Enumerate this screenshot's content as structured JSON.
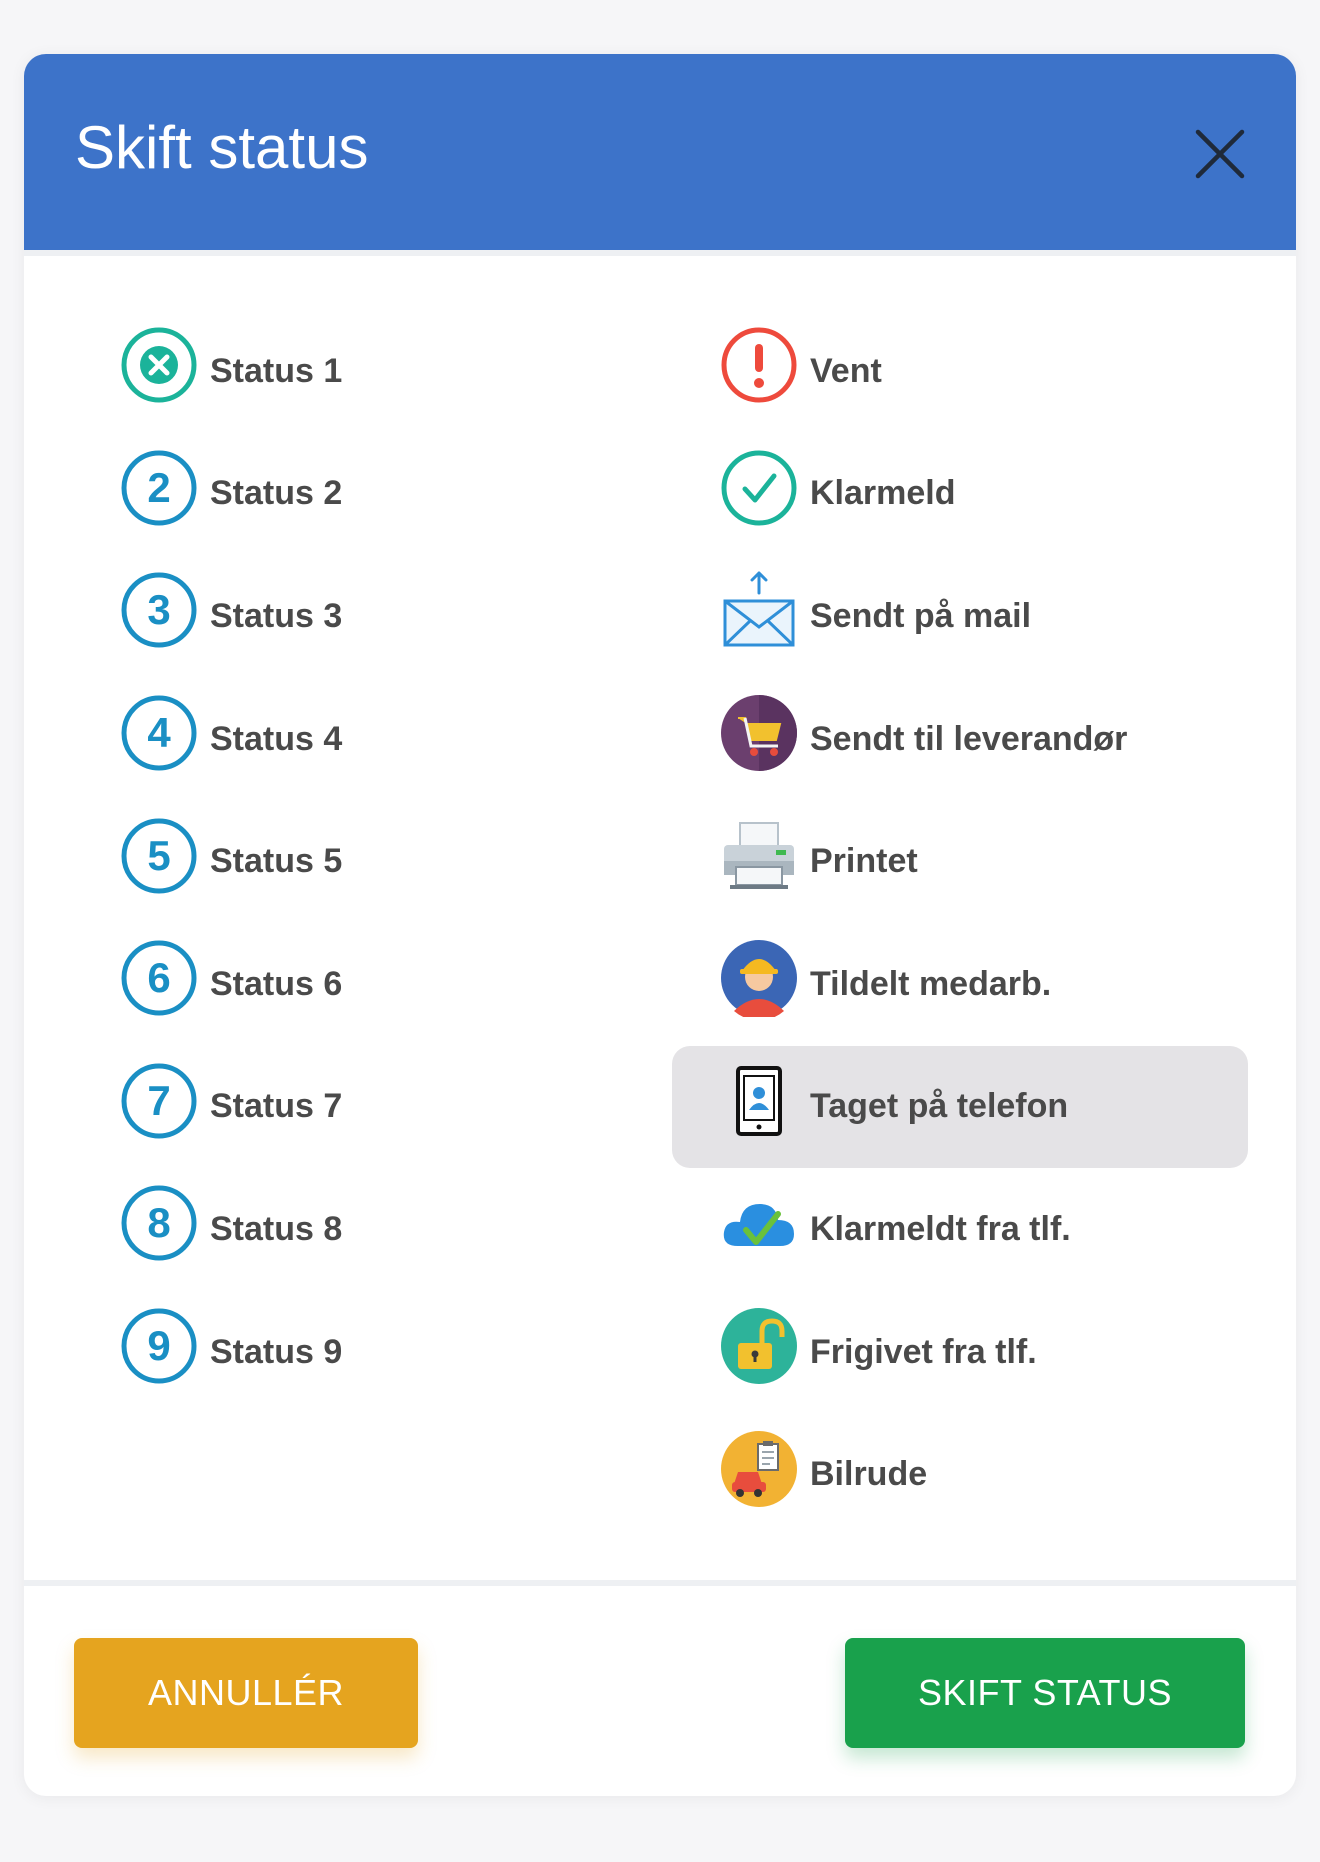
{
  "modal": {
    "title": "Skift status",
    "close_icon": "close-icon"
  },
  "left_column": [
    {
      "label": "Status 1",
      "icon": "x-circle-icon",
      "color": "#1bb39a"
    },
    {
      "label": "Status 2",
      "icon": "number-2-circle-icon",
      "number": "2",
      "color": "#1a8fc4"
    },
    {
      "label": "Status 3",
      "icon": "number-3-circle-icon",
      "number": "3",
      "color": "#1a8fc4"
    },
    {
      "label": "Status 4",
      "icon": "number-4-circle-icon",
      "number": "4",
      "color": "#1a8fc4"
    },
    {
      "label": "Status 5",
      "icon": "number-5-circle-icon",
      "number": "5",
      "color": "#1a8fc4"
    },
    {
      "label": "Status 6",
      "icon": "number-6-circle-icon",
      "number": "6",
      "color": "#1a8fc4"
    },
    {
      "label": "Status 7",
      "icon": "number-7-circle-icon",
      "number": "7",
      "color": "#1a8fc4"
    },
    {
      "label": "Status 8",
      "icon": "number-8-circle-icon",
      "number": "8",
      "color": "#1a8fc4"
    },
    {
      "label": "Status 9",
      "icon": "number-9-circle-icon",
      "number": "9",
      "color": "#1a8fc4"
    }
  ],
  "right_column": [
    {
      "label": "Vent",
      "icon": "exclamation-circle-icon",
      "color": "#ee4a3c"
    },
    {
      "label": "Klarmeld",
      "icon": "check-circle-icon",
      "color": "#1bb39a"
    },
    {
      "label": "Sendt på mail",
      "icon": "mail-send-icon",
      "color": "#2f8fd8"
    },
    {
      "label": "Sendt til leverandør",
      "icon": "shopping-cart-icon",
      "color": "#6b3f6e"
    },
    {
      "label": "Printet",
      "icon": "printer-icon",
      "color": "#6d7a85"
    },
    {
      "label": "Tildelt medarb.",
      "icon": "worker-avatar-icon",
      "color": "#3b66b5"
    },
    {
      "label": "Taget på telefon",
      "icon": "phone-contact-icon",
      "color": "#111111",
      "selected": true
    },
    {
      "label": "Klarmeldt fra tlf.",
      "icon": "cloud-check-icon",
      "color": "#2a8fe0"
    },
    {
      "label": "Frigivet fra tlf.",
      "icon": "unlocked-padlock-icon",
      "color": "#2db39a"
    },
    {
      "label": "Bilrude",
      "icon": "car-clipboard-icon",
      "color": "#f2b233"
    }
  ],
  "footer": {
    "cancel_label": "ANNULLÉR",
    "submit_label": "SKIFT STATUS",
    "cancel_color": "#e5a41f",
    "submit_color": "#19a14c"
  }
}
